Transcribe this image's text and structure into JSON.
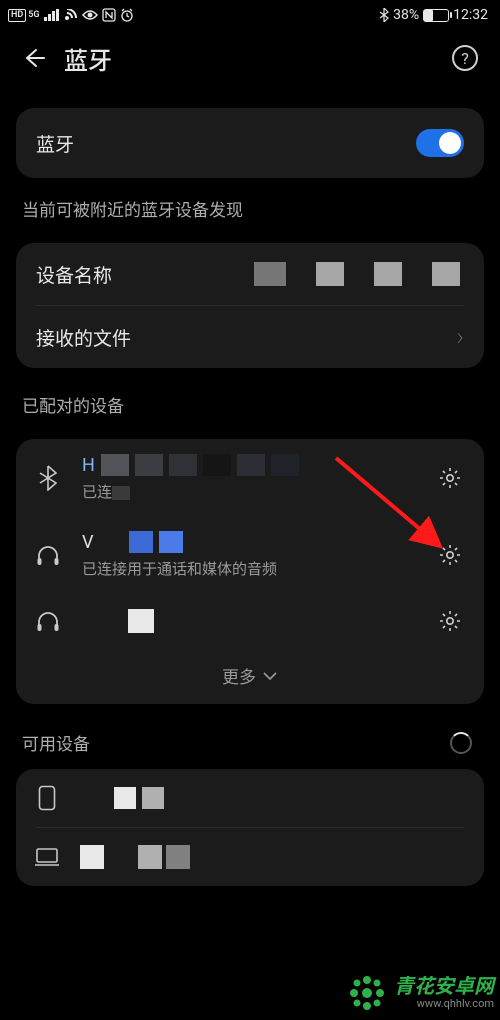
{
  "status": {
    "battery_pct": "38%",
    "time": "12:32"
  },
  "app_bar": {
    "title": "蓝牙"
  },
  "bluetooth_toggle": {
    "label": "蓝牙",
    "on": true
  },
  "discoverable_note": "当前可被附近的蓝牙设备发现",
  "rows": {
    "device_name_label": "设备名称",
    "received_files_label": "接收的文件"
  },
  "paired": {
    "section_label": "已配对的设备",
    "devices": [
      {
        "icon": "bluetooth",
        "name_first_char": "H",
        "status_partial": "已连",
        "sub": ""
      },
      {
        "icon": "headphones",
        "sub": "已连接用于通话和媒体的音频"
      },
      {
        "icon": "headphones",
        "sub": ""
      }
    ],
    "more_label": "更多"
  },
  "available": {
    "section_label": "可用设备"
  },
  "watermark": {
    "brand": "青花安卓网",
    "url": "www.qhhlv.com"
  },
  "colors": {
    "accent": "#1f71e8",
    "brand_green": "#2fb04a"
  }
}
